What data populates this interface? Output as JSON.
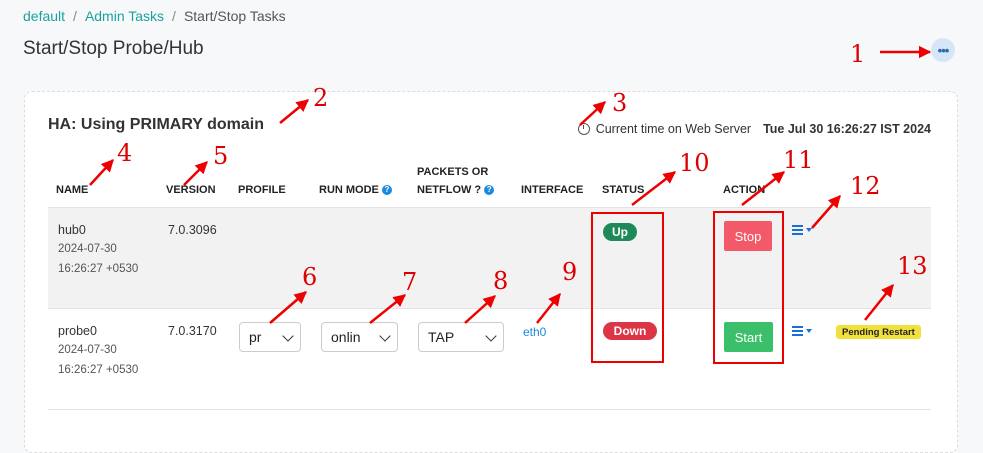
{
  "breadcrumb": {
    "items": [
      "default",
      "Admin Tasks",
      "Start/Stop Tasks"
    ],
    "sep": "/"
  },
  "page_title": "Start/Stop Probe/Hub",
  "more_icon_glyph": "•••",
  "ha_status": "HA: Using PRIMARY domain",
  "server_time": {
    "label": "Current time on Web Server",
    "value": "Tue Jul 30 16:26:27 IST 2024"
  },
  "columns": {
    "name": "NAME",
    "version": "VERSION",
    "profile": "PROFILE",
    "run_mode": "RUN MODE",
    "packets_line1": "PACKETS OR",
    "packets_line2": "NETFLOW ?",
    "interface": "INTERFACE",
    "status": "STATUS",
    "action": "ACTION"
  },
  "help_glyph": "?",
  "rows": [
    {
      "name": "hub0",
      "date": "2024-07-30",
      "time": "16:26:27 +0530",
      "version": "7.0.3096",
      "status": "Up",
      "action": "Stop"
    },
    {
      "name": "probe0",
      "date": "2024-07-30",
      "time": "16:26:27 +0530",
      "version": "7.0.3170",
      "profile": "pr",
      "run_mode": "onlin",
      "packets": "TAP",
      "interface": "eth0",
      "status": "Down",
      "action": "Start",
      "pending": "Pending Restart"
    }
  ],
  "annotations": [
    "1",
    "2",
    "3",
    "4",
    "5",
    "6",
    "7",
    "8",
    "9",
    "10",
    "11",
    "12",
    "13"
  ],
  "colors": {
    "accent": "#1aa39a",
    "up": "#1e8a5a",
    "down": "#dc3545",
    "stop": "#f25a6a",
    "start": "#3cbf6b",
    "annotation": "#e00000"
  }
}
